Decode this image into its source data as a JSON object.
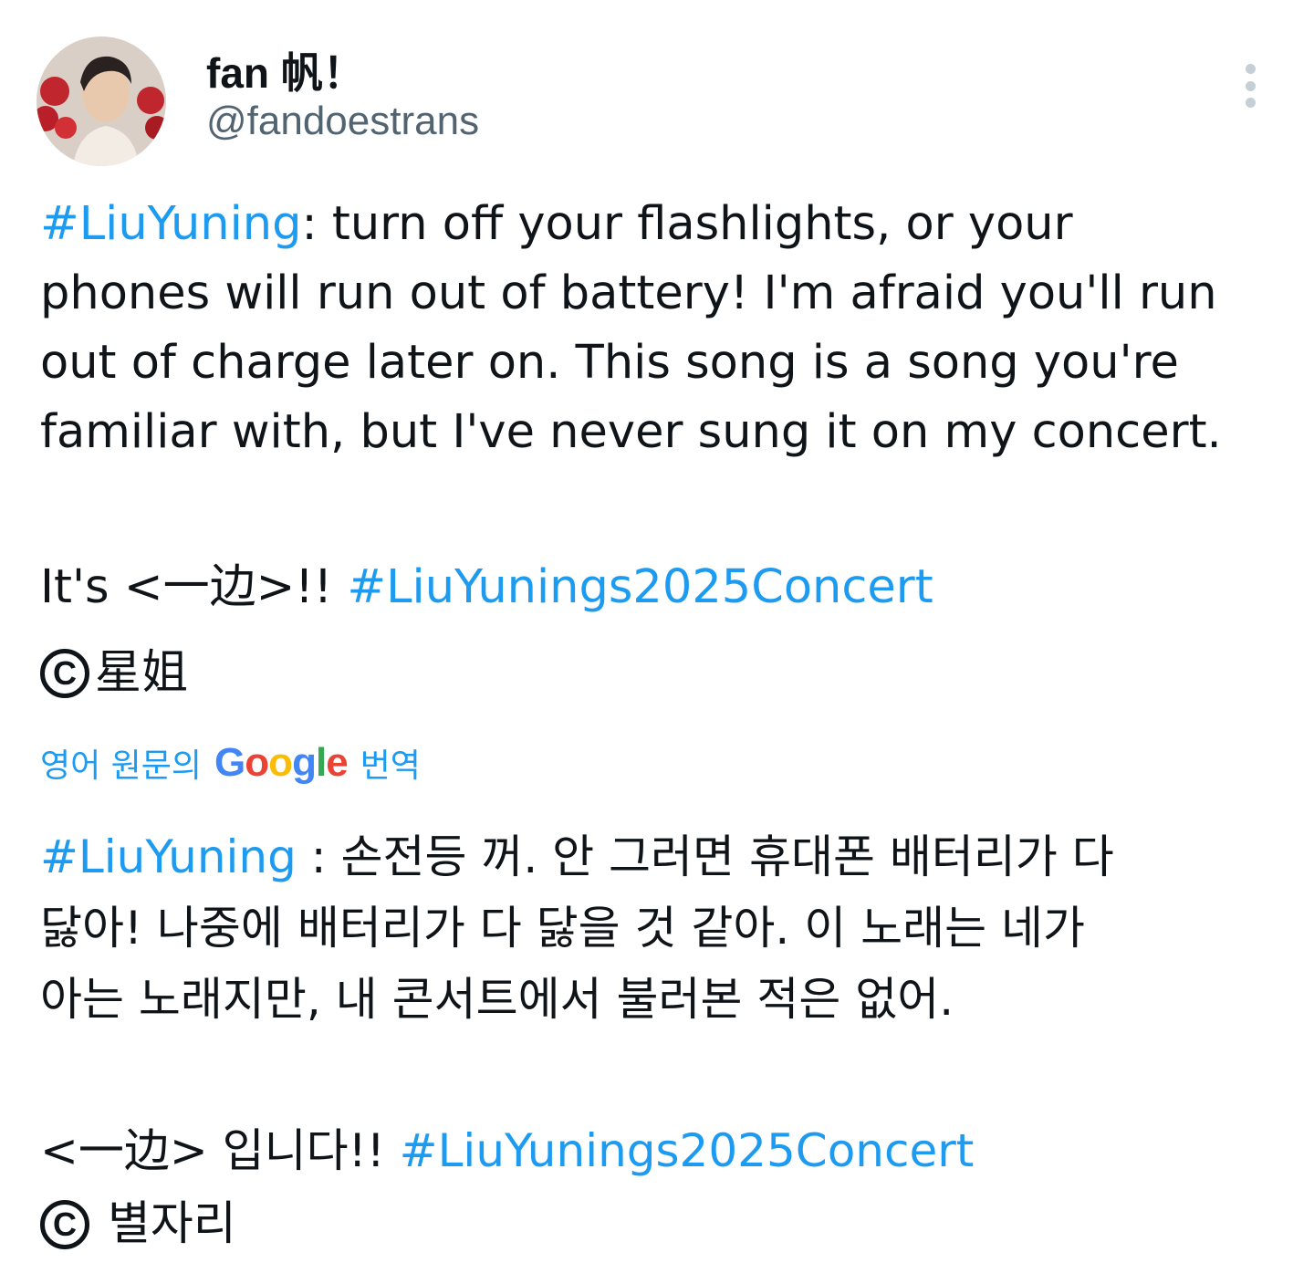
{
  "author": {
    "display_name": "fan 帆！",
    "handle": "@fandoestrans"
  },
  "colors": {
    "hashtag": "#1d9bf0",
    "text": "#0f1419",
    "muted": "#536471"
  },
  "icons": {
    "more": "more-vertical-icon",
    "copyright": "copyright-icon"
  },
  "tweet": {
    "hashtag_main": "#LiuYuning",
    "line1_rest": ": turn off your flashlights, or your",
    "line2": "phones will run out of battery! I'm afraid you'll run",
    "line3": "out of charge later on. This song is a song you're",
    "line4": "familiar with, but I've never sung it on my concert.",
    "line5_prefix": "It's <一边>!! ",
    "hashtag_concert": "#LiuYunings2025Concert",
    "copyright_glyph": "C",
    "credit": "星姐"
  },
  "translation": {
    "label_prefix": "영어 원문의",
    "google_letters": [
      "G",
      "o",
      "o",
      "g",
      "l",
      "e"
    ],
    "label_suffix": "번역",
    "hashtag_main": "#LiuYuning",
    "line1_rest": " : 손전등 꺼. 안 그러면 휴대폰 배터리가 다",
    "line2": "닳아! 나중에 배터리가 다 닳을 것 같아. 이 노래는 네가",
    "line3": "아는 노래지만, 내 콘서트에서 불러본 적은 없어.",
    "line4_prefix": "<一边> 입니다!! ",
    "hashtag_concert": "#LiuYunings2025Concert",
    "copyright_glyph": "C",
    "credit": "별자리"
  }
}
